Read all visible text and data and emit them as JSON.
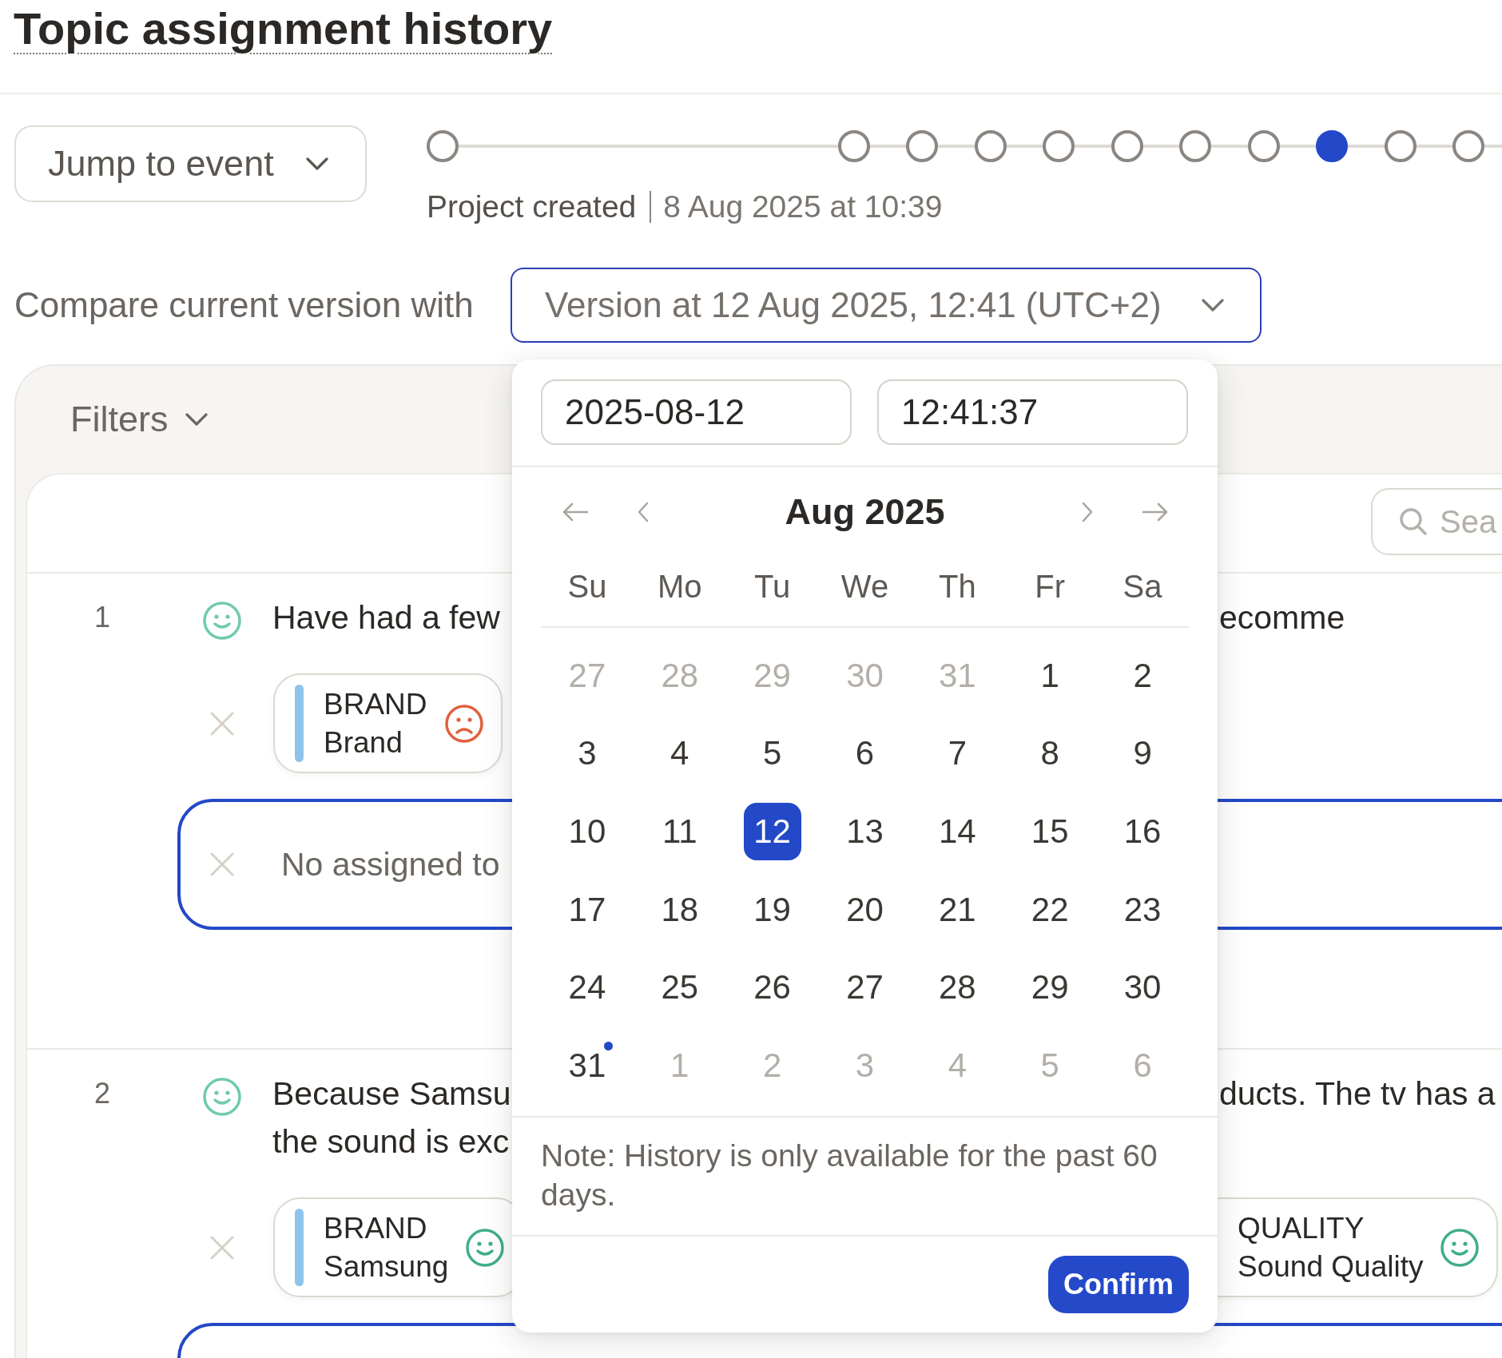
{
  "header": {
    "title": "Topic assignment history"
  },
  "toolbar": {
    "jump_button": {
      "label": "Jump to event"
    },
    "timeline": {
      "events": [
        {
          "selected": false
        },
        {
          "selected": false
        },
        {
          "selected": false
        },
        {
          "selected": false
        },
        {
          "selected": false
        },
        {
          "selected": false
        },
        {
          "selected": false
        },
        {
          "selected": false
        },
        {
          "selected": true
        },
        {
          "selected": false
        },
        {
          "selected": false
        }
      ],
      "caption": {
        "event": "Project created",
        "time": "8 Aug 2025 at 10:39"
      }
    }
  },
  "compare": {
    "label": "Compare current version with",
    "value": "Version at 12 Aug 2025, 12:41 (UTC+2)",
    "expanded": true
  },
  "filters": {
    "label": "Filters"
  },
  "search": {
    "placeholder": "Sea"
  },
  "rows": [
    {
      "number": "1",
      "positive": true,
      "text_left": [
        "Have had a few"
      ],
      "text_right": [
        "ecomme"
      ],
      "topics_left": [
        {
          "category": "BRAND",
          "name": "Brand",
          "positive": false
        }
      ],
      "comparison": {
        "highlighted": true,
        "text": "No assigned to"
      }
    },
    {
      "number": "2",
      "positive": true,
      "text_left": [
        "Because Samsu",
        "the sound is exc"
      ],
      "text_right": [
        "ducts. The tv has a"
      ],
      "topics_left": [
        {
          "category": "BRAND",
          "name": "Samsung",
          "positive": true
        }
      ],
      "topics_right": [
        {
          "category": "QUALITY",
          "name": "Sound Quality",
          "positive": true
        }
      ],
      "comparison": {
        "highlighted": true
      }
    }
  ],
  "date_picker": {
    "date": "2025-08-12",
    "time": "12:41:37",
    "month": "Aug 2025",
    "weekdays": [
      "Su",
      "Mo",
      "Tu",
      "We",
      "Th",
      "Fr",
      "Sa"
    ],
    "days": [
      {
        "label": "27",
        "in_month": false,
        "selected": false,
        "marked": false
      },
      {
        "label": "28",
        "in_month": false,
        "selected": false,
        "marked": false
      },
      {
        "label": "29",
        "in_month": false,
        "selected": false,
        "marked": false
      },
      {
        "label": "30",
        "in_month": false,
        "selected": false,
        "marked": false
      },
      {
        "label": "31",
        "in_month": false,
        "selected": false,
        "marked": false
      },
      {
        "label": "1",
        "in_month": true,
        "selected": false,
        "marked": false
      },
      {
        "label": "2",
        "in_month": true,
        "selected": false,
        "marked": false
      },
      {
        "label": "3",
        "in_month": true,
        "selected": false,
        "marked": false
      },
      {
        "label": "4",
        "in_month": true,
        "selected": false,
        "marked": false
      },
      {
        "label": "5",
        "in_month": true,
        "selected": false,
        "marked": false
      },
      {
        "label": "6",
        "in_month": true,
        "selected": false,
        "marked": false
      },
      {
        "label": "7",
        "in_month": true,
        "selected": false,
        "marked": false
      },
      {
        "label": "8",
        "in_month": true,
        "selected": false,
        "marked": false
      },
      {
        "label": "9",
        "in_month": true,
        "selected": false,
        "marked": false
      },
      {
        "label": "10",
        "in_month": true,
        "selected": false,
        "marked": false
      },
      {
        "label": "11",
        "in_month": true,
        "selected": false,
        "marked": false
      },
      {
        "label": "12",
        "in_month": true,
        "selected": true,
        "marked": false
      },
      {
        "label": "13",
        "in_month": true,
        "selected": false,
        "marked": false
      },
      {
        "label": "14",
        "in_month": true,
        "selected": false,
        "marked": false
      },
      {
        "label": "15",
        "in_month": true,
        "selected": false,
        "marked": false
      },
      {
        "label": "16",
        "in_month": true,
        "selected": false,
        "marked": false
      },
      {
        "label": "17",
        "in_month": true,
        "selected": false,
        "marked": false
      },
      {
        "label": "18",
        "in_month": true,
        "selected": false,
        "marked": false
      },
      {
        "label": "19",
        "in_month": true,
        "selected": false,
        "marked": false
      },
      {
        "label": "20",
        "in_month": true,
        "selected": false,
        "marked": false
      },
      {
        "label": "21",
        "in_month": true,
        "selected": false,
        "marked": false
      },
      {
        "label": "22",
        "in_month": true,
        "selected": false,
        "marked": false
      },
      {
        "label": "23",
        "in_month": true,
        "selected": false,
        "marked": false
      },
      {
        "label": "24",
        "in_month": true,
        "selected": false,
        "marked": false
      },
      {
        "label": "25",
        "in_month": true,
        "selected": false,
        "marked": false
      },
      {
        "label": "26",
        "in_month": true,
        "selected": false,
        "marked": false
      },
      {
        "label": "27",
        "in_month": true,
        "selected": false,
        "marked": false
      },
      {
        "label": "28",
        "in_month": true,
        "selected": false,
        "marked": false
      },
      {
        "label": "29",
        "in_month": true,
        "selected": false,
        "marked": false
      },
      {
        "label": "30",
        "in_month": true,
        "selected": false,
        "marked": false
      },
      {
        "label": "31",
        "in_month": true,
        "selected": false,
        "marked": true
      },
      {
        "label": "1",
        "in_month": false,
        "selected": false,
        "marked": false
      },
      {
        "label": "2",
        "in_month": false,
        "selected": false,
        "marked": false
      },
      {
        "label": "3",
        "in_month": false,
        "selected": false,
        "marked": false
      },
      {
        "label": "4",
        "in_month": false,
        "selected": false,
        "marked": false
      },
      {
        "label": "5",
        "in_month": false,
        "selected": false,
        "marked": false
      },
      {
        "label": "6",
        "in_month": false,
        "selected": false,
        "marked": false
      }
    ],
    "note": "Note: History is only available for the past 60 days.",
    "confirm": "Confirm"
  }
}
